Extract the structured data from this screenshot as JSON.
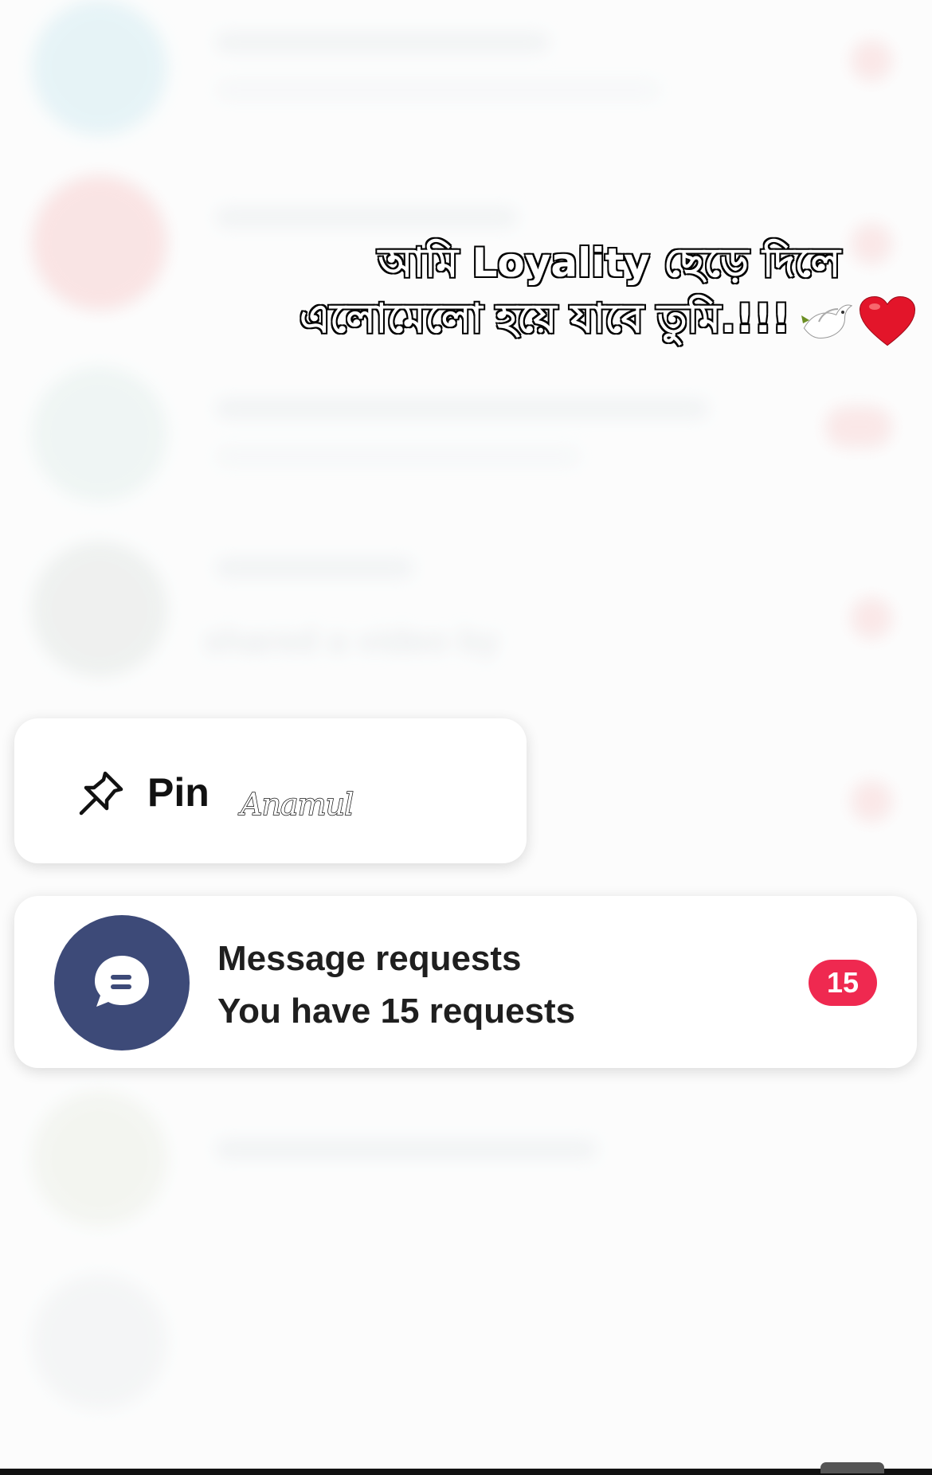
{
  "background": {
    "preview_text": "shared a video by"
  },
  "caption": {
    "line1": "আমি Loyality ছেড়ে দিলে",
    "line2": "এলোমেলো হয়ে যাবে তুমি.!!!",
    "icons": [
      "dove-icon",
      "heart-icon"
    ]
  },
  "context_menu": {
    "pin_label": "Pin"
  },
  "watermark": "Anamul",
  "message_requests": {
    "title": "Message requests",
    "subtitle": "You have 15 requests",
    "badge": "15",
    "badge_color": "#ef2950",
    "avatar_color": "#3d4a78"
  }
}
